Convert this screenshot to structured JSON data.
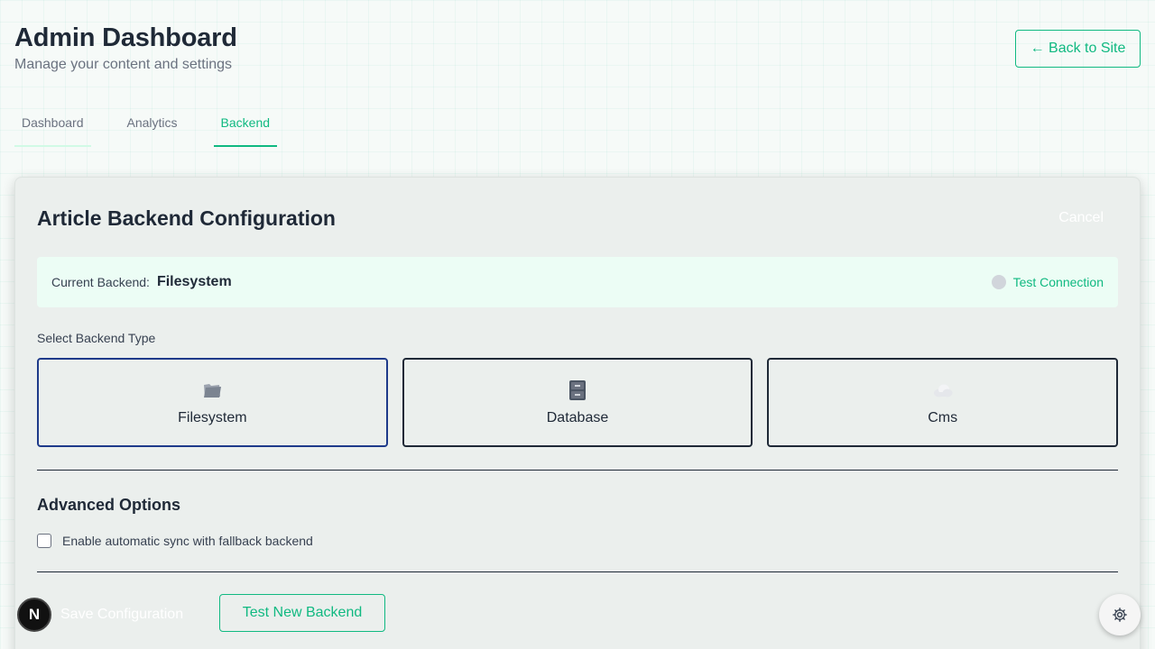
{
  "header": {
    "title": "Admin Dashboard",
    "subtitle": "Manage your content and settings",
    "back_label": "← Back to Site"
  },
  "tabs": [
    {
      "label": "Dashboard",
      "active": false
    },
    {
      "label": "Analytics",
      "active": false
    },
    {
      "label": "Backend",
      "active": true
    }
  ],
  "config": {
    "title": "Article Backend Configuration",
    "cancel_label": "Cancel",
    "current_label": "Current Backend:",
    "current_value": "Filesystem",
    "test_connection_label": "Test Connection",
    "select_label": "Select Backend Type",
    "options": [
      {
        "label": "Filesystem",
        "icon": "folder-icon",
        "selected": true
      },
      {
        "label": "Database",
        "icon": "file-cabinet-icon",
        "selected": false
      },
      {
        "label": "Cms",
        "icon": "cloud-icon",
        "selected": false
      }
    ],
    "advanced_title": "Advanced Options",
    "sync_label": "Enable automatic sync with fallback backend",
    "sync_checked": false,
    "save_label": "Save Configuration",
    "test_backend_label": "Test New Backend"
  },
  "floating": {
    "badge_letter": "N"
  },
  "colors": {
    "accent": "#10b981",
    "selected_border": "#1e3a8a",
    "text": "#1f2937"
  }
}
